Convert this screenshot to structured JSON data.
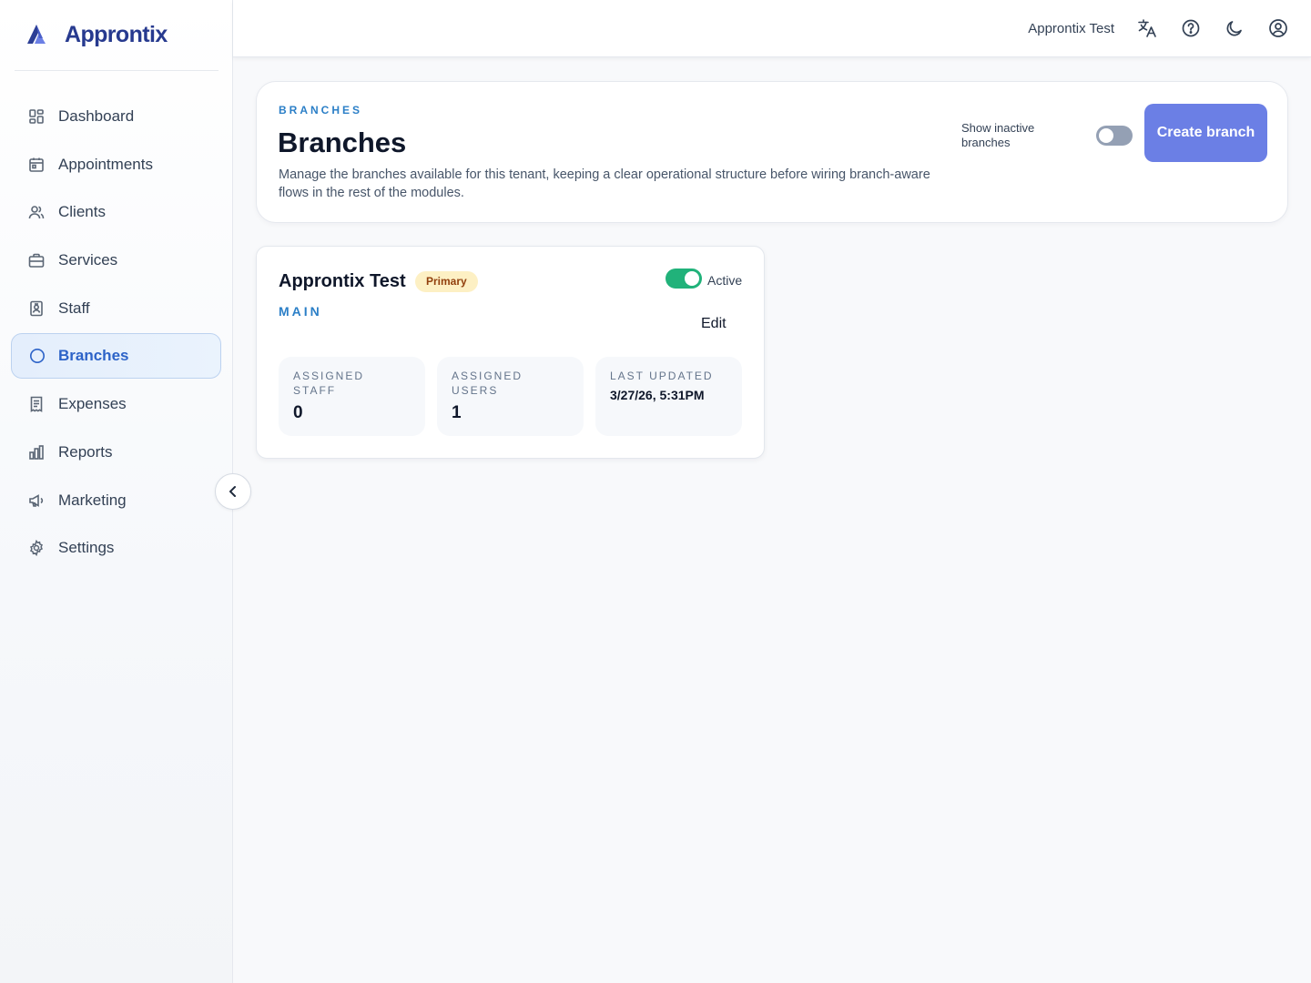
{
  "brand": {
    "name": "Approntix"
  },
  "sidebar": {
    "items": [
      {
        "label": "Dashboard",
        "icon": "dashboard-icon"
      },
      {
        "label": "Appointments",
        "icon": "calendar-icon"
      },
      {
        "label": "Clients",
        "icon": "users-icon"
      },
      {
        "label": "Services",
        "icon": "briefcase-icon"
      },
      {
        "label": "Staff",
        "icon": "badge-icon"
      },
      {
        "label": "Branches",
        "icon": "circle-icon",
        "active": true
      },
      {
        "label": "Expenses",
        "icon": "receipt-icon"
      },
      {
        "label": "Reports",
        "icon": "bar-chart-icon"
      },
      {
        "label": "Marketing",
        "icon": "megaphone-icon"
      },
      {
        "label": "Settings",
        "icon": "gear-icon"
      }
    ]
  },
  "topbar": {
    "tenant_name": "Approntix Test",
    "icons": [
      "translate-icon",
      "help-icon",
      "moon-icon",
      "user-circle-icon"
    ]
  },
  "header": {
    "eyebrow": "BRANCHES",
    "title": "Branches",
    "description": "Manage the branches available for this tenant, keeping a clear operational structure before wiring branch-aware flows in the rest of the modules.",
    "show_inactive_label": "Show inactive branches",
    "show_inactive_enabled": false,
    "create_button_label": "Create branch"
  },
  "branches": [
    {
      "name": "Approntix Test",
      "badge": "Primary",
      "code": "MAIN",
      "status_label": "Active",
      "active": true,
      "edit_label": "Edit",
      "stats": [
        {
          "label": "Assigned staff",
          "value": "0"
        },
        {
          "label": "Assigned users",
          "value": "1"
        },
        {
          "label": "Last updated",
          "value": "3/27/26, 5:31PM"
        }
      ]
    }
  ],
  "colors": {
    "brand": "#273a8f",
    "accent": "#2b7fc7",
    "active_nav": "#2d63c8",
    "primary_button": "#6b7fe5",
    "toggle_on": "#21b27a",
    "toggle_off": "#94a0b4",
    "badge_bg": "#fdf0c4",
    "badge_text": "#92400e"
  }
}
